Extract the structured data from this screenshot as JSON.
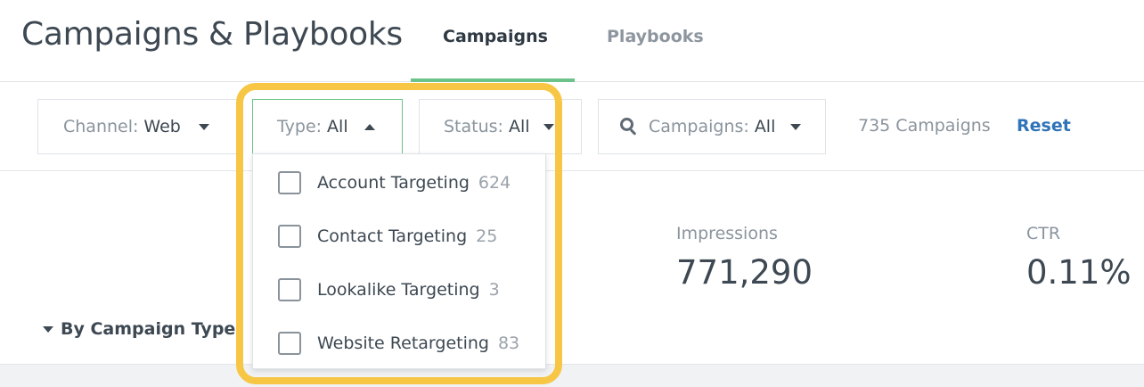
{
  "header": {
    "title": "Campaigns & Playbooks",
    "tabs": [
      {
        "label": "Campaigns",
        "active": true
      },
      {
        "label": "Playbooks",
        "active": false
      }
    ]
  },
  "filters": {
    "channel": {
      "key": "Channel:",
      "value": "Web"
    },
    "type": {
      "key": "Type:",
      "value": "All",
      "open": true
    },
    "status": {
      "key": "Status:",
      "value": "All"
    },
    "campaigns": {
      "key": "Campaigns:",
      "value": "All",
      "icon": "search-icon"
    }
  },
  "count_text": "735 Campaigns",
  "reset_label": "Reset",
  "type_dropdown": {
    "options": [
      {
        "label": "Account Targeting",
        "count": "624",
        "checked": false
      },
      {
        "label": "Contact Targeting",
        "count": "25",
        "checked": false
      },
      {
        "label": "Lookalike Targeting",
        "count": "3",
        "checked": false
      },
      {
        "label": "Website Retargeting",
        "count": "83",
        "checked": false
      }
    ]
  },
  "metrics": {
    "impressions": {
      "label": "Impressions",
      "value": "771,290"
    },
    "ctr": {
      "label": "CTR",
      "value": "0.11%"
    }
  },
  "section": {
    "label": "By Campaign Type",
    "expanded": true
  },
  "colors": {
    "accent_green": "#6cc389",
    "link_blue": "#2f73b8",
    "highlight_yellow": "#f6c644"
  }
}
